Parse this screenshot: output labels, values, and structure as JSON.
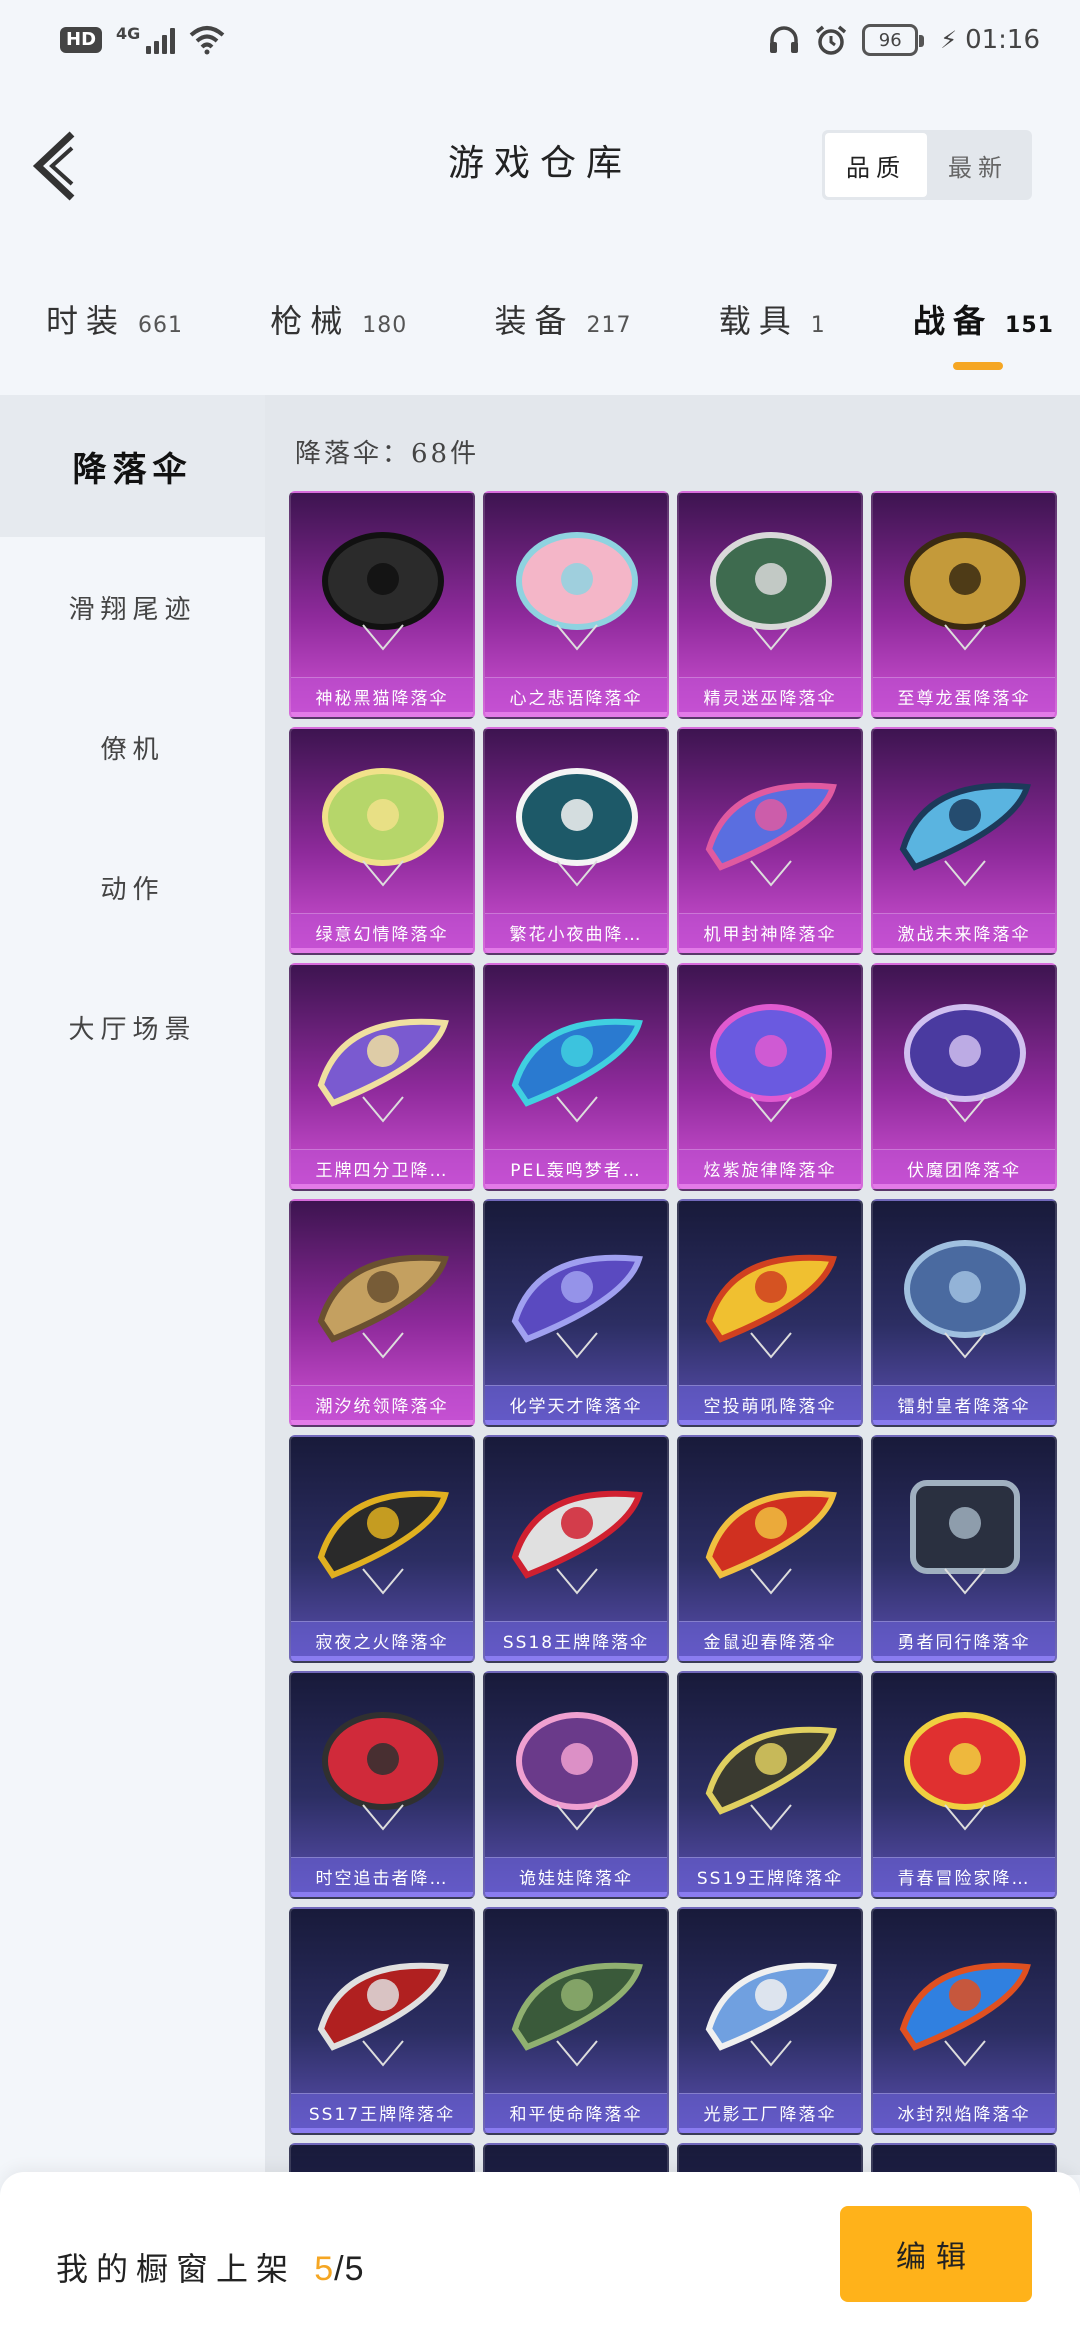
{
  "status_bar": {
    "hd": "HD",
    "network": "4G",
    "battery": "96",
    "time": "01:16",
    "icons": [
      "headphones-icon",
      "alarm-icon",
      "charging-icon"
    ]
  },
  "header": {
    "title": "游戏仓库",
    "sort_options": [
      {
        "label": "品质",
        "active": true
      },
      {
        "label": "最新",
        "active": false
      }
    ]
  },
  "categories": [
    {
      "name": "时装",
      "count": "661",
      "active": false
    },
    {
      "name": "枪械",
      "count": "180",
      "active": false
    },
    {
      "name": "装备",
      "count": "217",
      "active": false
    },
    {
      "name": "载具",
      "count": "1",
      "active": false
    },
    {
      "name": "战备",
      "count": "151",
      "active": true
    }
  ],
  "sidebar": {
    "items": [
      {
        "label": "降落伞",
        "active": true
      },
      {
        "label": "滑翔尾迹",
        "active": false
      },
      {
        "label": "僚机",
        "active": false
      },
      {
        "label": "动作",
        "active": false
      },
      {
        "label": "大厅场景",
        "active": false
      }
    ]
  },
  "main": {
    "count_line": "降落伞：68件",
    "items": [
      {
        "name": "神秘黑猫降落伞",
        "tier": "purple",
        "c1": "#2b2b2b",
        "c2": "#111111",
        "shape": "round"
      },
      {
        "name": "心之悲语降落伞",
        "tier": "purple",
        "c1": "#f4b6c8",
        "c2": "#8fd3e0",
        "shape": "round"
      },
      {
        "name": "精灵迷巫降落伞",
        "tier": "purple",
        "c1": "#3e6b4f",
        "c2": "#d9d9d9",
        "shape": "round"
      },
      {
        "name": "至尊龙蛋降落伞",
        "tier": "purple",
        "c1": "#c49a3a",
        "c2": "#3a2a12",
        "shape": "round"
      },
      {
        "name": "绿意幻情降落伞",
        "tier": "purple",
        "c1": "#b6d66a",
        "c2": "#f1e28a",
        "shape": "round"
      },
      {
        "name": "繁花小夜曲降…",
        "tier": "purple",
        "c1": "#1d5968",
        "c2": "#f4f4f4",
        "shape": "round"
      },
      {
        "name": "机甲封神降落伞",
        "tier": "purple",
        "c1": "#5a6ee0",
        "c2": "#e05aa0",
        "shape": "wing"
      },
      {
        "name": "激战未来降落伞",
        "tier": "purple",
        "c1": "#5ab4e0",
        "c2": "#1c3a5a",
        "shape": "wing"
      },
      {
        "name": "王牌四分卫降…",
        "tier": "purple",
        "c1": "#7a5ad0",
        "c2": "#f0e0a0",
        "shape": "wing"
      },
      {
        "name": "PEL轰鸣梦者…",
        "tier": "purple",
        "c1": "#2a7ad0",
        "c2": "#40d0e0",
        "shape": "wing"
      },
      {
        "name": "炫紫旋律降落伞",
        "tier": "purple",
        "c1": "#6a5ae0",
        "c2": "#e05ad0",
        "shape": "round"
      },
      {
        "name": "伏魔团降落伞",
        "tier": "purple",
        "c1": "#4a3aa0",
        "c2": "#d0c0f0",
        "shape": "round"
      },
      {
        "name": "潮汐统领降落伞",
        "tier": "purple",
        "c1": "#c4a060",
        "c2": "#6a5030",
        "shape": "wing"
      },
      {
        "name": "化学天才降落伞",
        "tier": "blue",
        "c1": "#5a4ac0",
        "c2": "#a0a0f0",
        "shape": "wing"
      },
      {
        "name": "空投萌吼降落伞",
        "tier": "blue",
        "c1": "#f0c030",
        "c2": "#d04020",
        "shape": "wing"
      },
      {
        "name": "镭射皇者降落伞",
        "tier": "blue",
        "c1": "#4a6aa0",
        "c2": "#a0c0e0",
        "shape": "round"
      },
      {
        "name": "寂夜之火降落伞",
        "tier": "blue",
        "c1": "#2a2a2a",
        "c2": "#e0b020",
        "shape": "wing"
      },
      {
        "name": "SS18王牌降落伞",
        "tier": "blue",
        "c1": "#e0e0e0",
        "c2": "#d02030",
        "shape": "wing"
      },
      {
        "name": "金鼠迎春降落伞",
        "tier": "blue",
        "c1": "#d03020",
        "c2": "#f0c040",
        "shape": "wing"
      },
      {
        "name": "勇者同行降落伞",
        "tier": "blue",
        "c1": "#2a3040",
        "c2": "#a0b0c0",
        "shape": "square"
      },
      {
        "name": "时空追击者降…",
        "tier": "blue",
        "c1": "#d02a3a",
        "c2": "#303030",
        "shape": "round"
      },
      {
        "name": "诡娃娃降落伞",
        "tier": "blue",
        "c1": "#6a3a8a",
        "c2": "#f0a0d0",
        "shape": "round"
      },
      {
        "name": "SS19王牌降落伞",
        "tier": "blue",
        "c1": "#3a3a30",
        "c2": "#e0d060",
        "shape": "wing"
      },
      {
        "name": "青春冒险家降…",
        "tier": "blue",
        "c1": "#e03030",
        "c2": "#f0d040",
        "shape": "round"
      },
      {
        "name": "SS17王牌降落伞",
        "tier": "blue",
        "c1": "#b02020",
        "c2": "#e0e0e0",
        "shape": "wing"
      },
      {
        "name": "和平使命降落伞",
        "tier": "blue",
        "c1": "#3a5a3a",
        "c2": "#90b070",
        "shape": "wing"
      },
      {
        "name": "光影工厂降落伞",
        "tier": "blue",
        "c1": "#70a0e0",
        "c2": "#f0f0f0",
        "shape": "wing"
      },
      {
        "name": "冰封烈焰降落伞",
        "tier": "blue",
        "c1": "#3080e0",
        "c2": "#e05020",
        "shape": "wing"
      },
      {
        "name": "",
        "tier": "blue",
        "c1": "#20243a",
        "c2": "#20243a",
        "shape": "none"
      },
      {
        "name": "",
        "tier": "blue",
        "c1": "#20243a",
        "c2": "#20243a",
        "shape": "none"
      },
      {
        "name": "",
        "tier": "blue",
        "c1": "#20243a",
        "c2": "#20243a",
        "shape": "none"
      },
      {
        "name": "",
        "tier": "blue",
        "c1": "#20243a",
        "c2": "#20243a",
        "shape": "none"
      }
    ]
  },
  "bottom_bar": {
    "showcase_label": "我的橱窗上架",
    "showcase_current": "5",
    "showcase_sep": "/",
    "showcase_total": "5",
    "edit_label": "编辑"
  },
  "colors": {
    "accent": "#f5a623",
    "edit_button": "#ffb21a",
    "purple_tier": "#b83ec2",
    "blue_tier": "#4a46a8"
  }
}
